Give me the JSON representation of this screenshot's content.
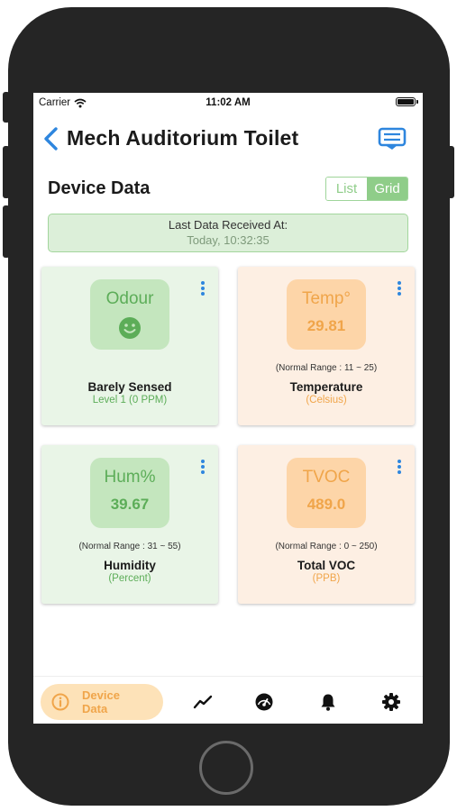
{
  "status_bar": {
    "carrier": "Carrier",
    "time": "11:02 AM"
  },
  "nav": {
    "title": "Mech Auditorium Toilet"
  },
  "section": {
    "title": "Device Data"
  },
  "view_toggle": {
    "list_label": "List",
    "grid_label": "Grid",
    "selected": "Grid"
  },
  "last_data": {
    "label": "Last Data Received At:",
    "value": "Today, 10:32:35"
  },
  "cards": [
    {
      "name": "Odour",
      "value": "",
      "icon": "smiley-icon",
      "range": "",
      "label": "Barely Sensed",
      "unit": "Level 1 (0 PPM)",
      "theme": "green"
    },
    {
      "name": "Temp°",
      "value": "29.81",
      "range": "(Normal Range : 11 ~ 25)",
      "label": "Temperature",
      "unit": "(Celsius)",
      "theme": "orange"
    },
    {
      "name": "Hum%",
      "value": "39.67",
      "range": "(Normal Range : 31 ~ 55)",
      "label": "Humidity",
      "unit": "(Percent)",
      "theme": "green"
    },
    {
      "name": "TVOC",
      "value": "489.0",
      "range": "(Normal Range : 0 ~ 250)",
      "label": "Total VOC",
      "unit": "(PPB)",
      "theme": "orange"
    }
  ],
  "tab_bar": {
    "active_label": "Device Data",
    "items": [
      "info-icon",
      "trend-chart-icon",
      "dashboard-gauge-icon",
      "bell-icon",
      "gear-icon"
    ]
  },
  "colors": {
    "accent_blue": "#2e86de",
    "green": "#5cad58",
    "orange": "#f0a54a",
    "toggle_green": "#8fcd89"
  }
}
